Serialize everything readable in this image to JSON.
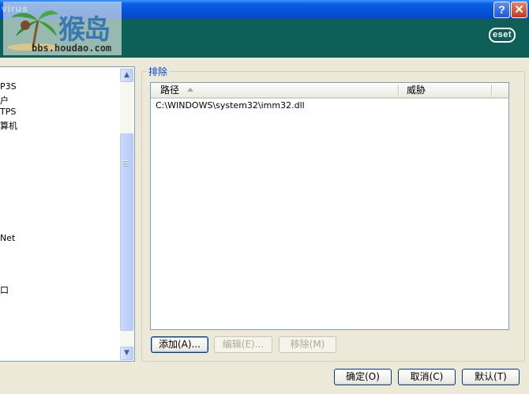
{
  "window": {
    "title_fragment": "virus",
    "help_glyph": "?",
    "close_glyph": "✕"
  },
  "brand": {
    "logo_text": "eset"
  },
  "watermark": {
    "site_name": "猴岛",
    "url": "bbs.houdao.com"
  },
  "tree": {
    "items": [
      "P3S",
      "户",
      "TPS",
      "算机",
      "Net",
      "口"
    ],
    "scroll_up_glyph": "▲",
    "scroll_down_glyph": "▼"
  },
  "exclusions": {
    "group_title": "排除",
    "columns": [
      "路径",
      "威胁"
    ],
    "rows": [
      {
        "path": "C:\\WINDOWS\\system32\\imm32.dll",
        "threat": ""
      }
    ],
    "buttons": {
      "add": "添加(A)...",
      "edit": "编辑(E)...",
      "remove": "移除(M)"
    }
  },
  "footer": {
    "ok": "确定(O)",
    "cancel": "取消(C)",
    "default": "默认(T)"
  },
  "colors": {
    "banner": "#0e5f57",
    "titlebar": "#0552d9",
    "group_title": "#0046d5"
  }
}
